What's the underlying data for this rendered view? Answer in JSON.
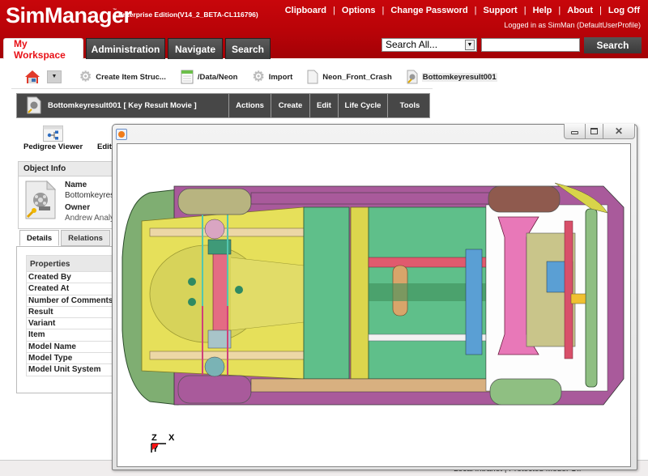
{
  "app": {
    "name": "SimManager",
    "trademark": "™",
    "edition": "Enterprise Edition(V14_2_BETA-CL116796)"
  },
  "toplinks": [
    "Clipboard",
    "Options",
    "Change Password",
    "Support",
    "Help",
    "About",
    "Log Off"
  ],
  "logged_in": "Logged in as SimMan (DefaultUserProfile)",
  "tabs": [
    {
      "label": "My Workspace",
      "active": true
    },
    {
      "label": "Administration",
      "active": false
    },
    {
      "label": "Navigate",
      "active": false
    },
    {
      "label": "Search",
      "active": false
    }
  ],
  "search": {
    "scope": "Search All...",
    "query": "",
    "button": "Search"
  },
  "breadcrumbs": [
    {
      "icon": "gear-icon",
      "label": "Create Item Struc..."
    },
    {
      "icon": "folder-calendar-icon",
      "label": "/Data/Neon"
    },
    {
      "icon": "gear-icon",
      "label": "Import"
    },
    {
      "icon": "document-icon",
      "label": "Neon_Front_Crash"
    },
    {
      "icon": "movie-document-icon",
      "label": "Bottomkeyresult001"
    }
  ],
  "item": {
    "title": "Bottomkeyresult001 [ Key Result Movie ]",
    "menus": [
      "Actions",
      "Create",
      "Edit",
      "Life Cycle",
      "Tools"
    ]
  },
  "actions": {
    "pedigree_viewer": "Pedigree Viewer",
    "edit": "Edit"
  },
  "object_info": {
    "header": "Object Info",
    "name_label": "Name",
    "name_value": "Bottomkeyres",
    "owner_label": "Owner",
    "owner_value": "Andrew Analy"
  },
  "detail_tabs": [
    {
      "label": "Details",
      "active": true
    },
    {
      "label": "Relations",
      "active": false
    }
  ],
  "properties": {
    "header": "Properties",
    "rows": [
      "Created By",
      "Created At",
      "Number of Comments",
      "Result",
      "Variant",
      "Item",
      "Model Name",
      "Model Type",
      "Model Unit System"
    ]
  },
  "viewer": {
    "axis_labels": {
      "z": "Z",
      "x": "X",
      "y": "Y"
    },
    "colors": {
      "yellow": "#e6e05a",
      "green": "#5fbf8a",
      "pink": "#d8508a",
      "magenta": "#a95a9b",
      "olive": "#b8b480",
      "tan": "#d8a56a",
      "blue": "#5a9fd4",
      "darkgreen": "#3e8f5a"
    }
  },
  "status": {
    "zone": "Local intranet | Protected Mode: Off"
  }
}
